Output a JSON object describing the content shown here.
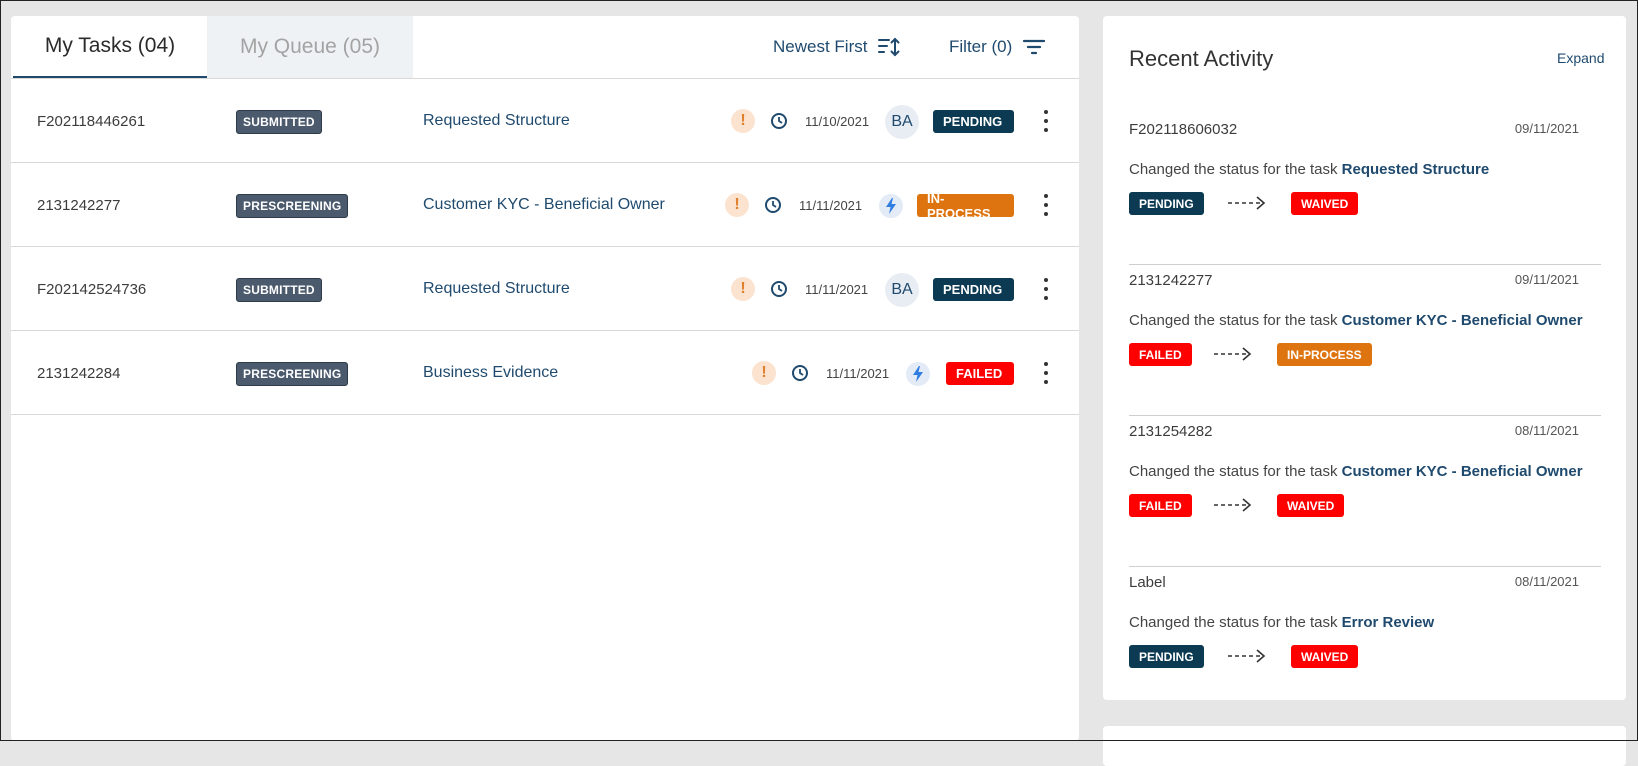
{
  "tabs": {
    "my_tasks": "My Tasks (04)",
    "my_queue": "My Queue (05)"
  },
  "toolbar": {
    "sort_label": "Newest First",
    "filter_label": "Filter (0)"
  },
  "colors": {
    "pending": "#0b3a52",
    "in_process": "#de7410",
    "failed": "#ff0000",
    "waived": "#ff0000",
    "link": "#1f4a6e"
  },
  "tasks": [
    {
      "id": "F202118446261",
      "stage": "SUBMITTED",
      "title": "Requested Structure",
      "date": "11/10/2021",
      "assignee": "BA",
      "status": "PENDING"
    },
    {
      "id": "2131242277",
      "stage": "PRESCREENING",
      "title": "Customer KYC - Beneficial Owner",
      "date": "11/11/2021",
      "assignee_icon": "lightning-icon",
      "status": "IN-PROCESS"
    },
    {
      "id": "F202142524736",
      "stage": "SUBMITTED",
      "title": "Requested Structure",
      "date": "11/11/2021",
      "assignee": "BA",
      "status": "PENDING"
    },
    {
      "id": "2131242284",
      "stage": "PRESCREENING",
      "title": "Business Evidence",
      "date": "11/11/2021",
      "assignee_icon": "lightning-icon",
      "status": "FAILED"
    }
  ],
  "activity": {
    "title": "Recent Activity",
    "expand_label": "Expand",
    "description_prefix": "Changed the status for the task",
    "items": [
      {
        "id": "F202118606032",
        "date": "09/11/2021",
        "task": "Requested Structure",
        "from": "PENDING",
        "to": "WAIVED"
      },
      {
        "id": "2131242277",
        "date": "09/11/2021",
        "task": "Customer KYC - Beneficial Owner",
        "from": "FAILED",
        "to": "IN-PROCESS"
      },
      {
        "id": "2131254282",
        "date": "08/11/2021",
        "task": "Customer KYC - Beneficial Owner",
        "from": "FAILED",
        "to": "WAIVED"
      },
      {
        "id": "Label",
        "date": "08/11/2021",
        "task": "Error Review",
        "from": "PENDING",
        "to": "WAIVED"
      }
    ]
  }
}
